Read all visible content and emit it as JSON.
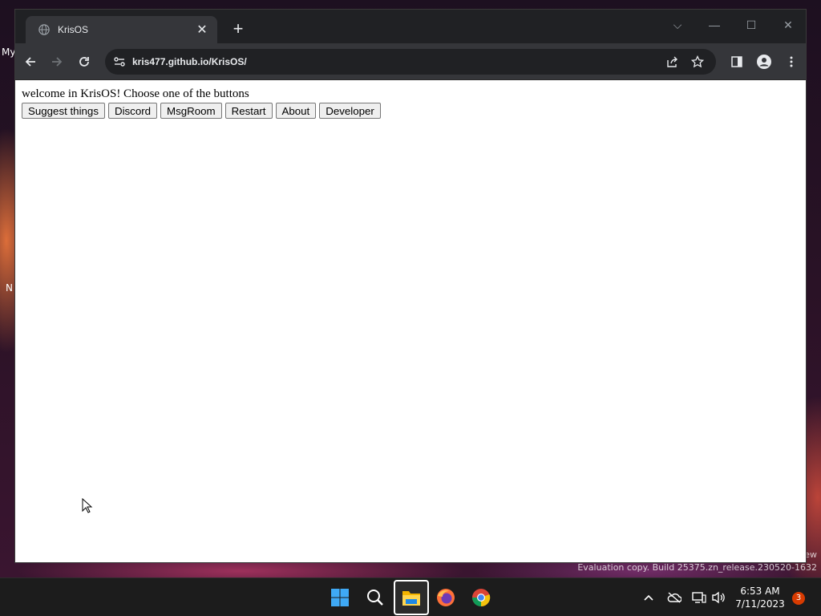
{
  "desktop": {
    "labels": [
      "My",
      "N"
    ],
    "watermark": {
      "line1": "ew",
      "line2": "Evaluation copy. Build 25375.zn_release.230520-1632"
    }
  },
  "browser": {
    "tab": {
      "title": "KrisOS",
      "icon": "globe-icon",
      "close_icon": "close-icon"
    },
    "new_tab_icon": "plus-icon",
    "window_controls": [
      "chevron-down-icon",
      "minimize-icon",
      "maximize-icon",
      "close-icon"
    ],
    "toolbar": {
      "back_icon": "back-arrow-icon",
      "forward_icon": "forward-arrow-icon",
      "reload_icon": "reload-icon",
      "site_info_icon": "site-settings-icon",
      "url": "kris477.github.io/KrisOS/",
      "share_icon": "share-icon",
      "bookmark_icon": "star-icon",
      "side_panel_icon": "side-panel-icon",
      "profile_icon": "profile-icon",
      "menu_icon": "kebab-menu-icon"
    }
  },
  "page": {
    "welcome": "welcome in KrisOS! Choose one of the buttons",
    "buttons": [
      "Suggest things",
      "Discord",
      "MsgRoom",
      "Restart",
      "About",
      "Developer"
    ]
  },
  "taskbar": {
    "apps": [
      "windows-start-icon",
      "search-icon",
      "file-explorer-icon",
      "firefox-icon",
      "chrome-icon"
    ],
    "active_app": "file-explorer-icon",
    "tray": [
      "chevron-up-icon",
      "onedrive-icon",
      "network-icon",
      "volume-icon"
    ],
    "time": "6:53 AM",
    "date": "7/11/2023",
    "notification_count": "3"
  },
  "colors": {
    "titlebar": "#202124",
    "toolbar": "#35363a",
    "omnibox": "#202124",
    "taskbar": "#1c1c1c",
    "badge": "#d83b01"
  }
}
